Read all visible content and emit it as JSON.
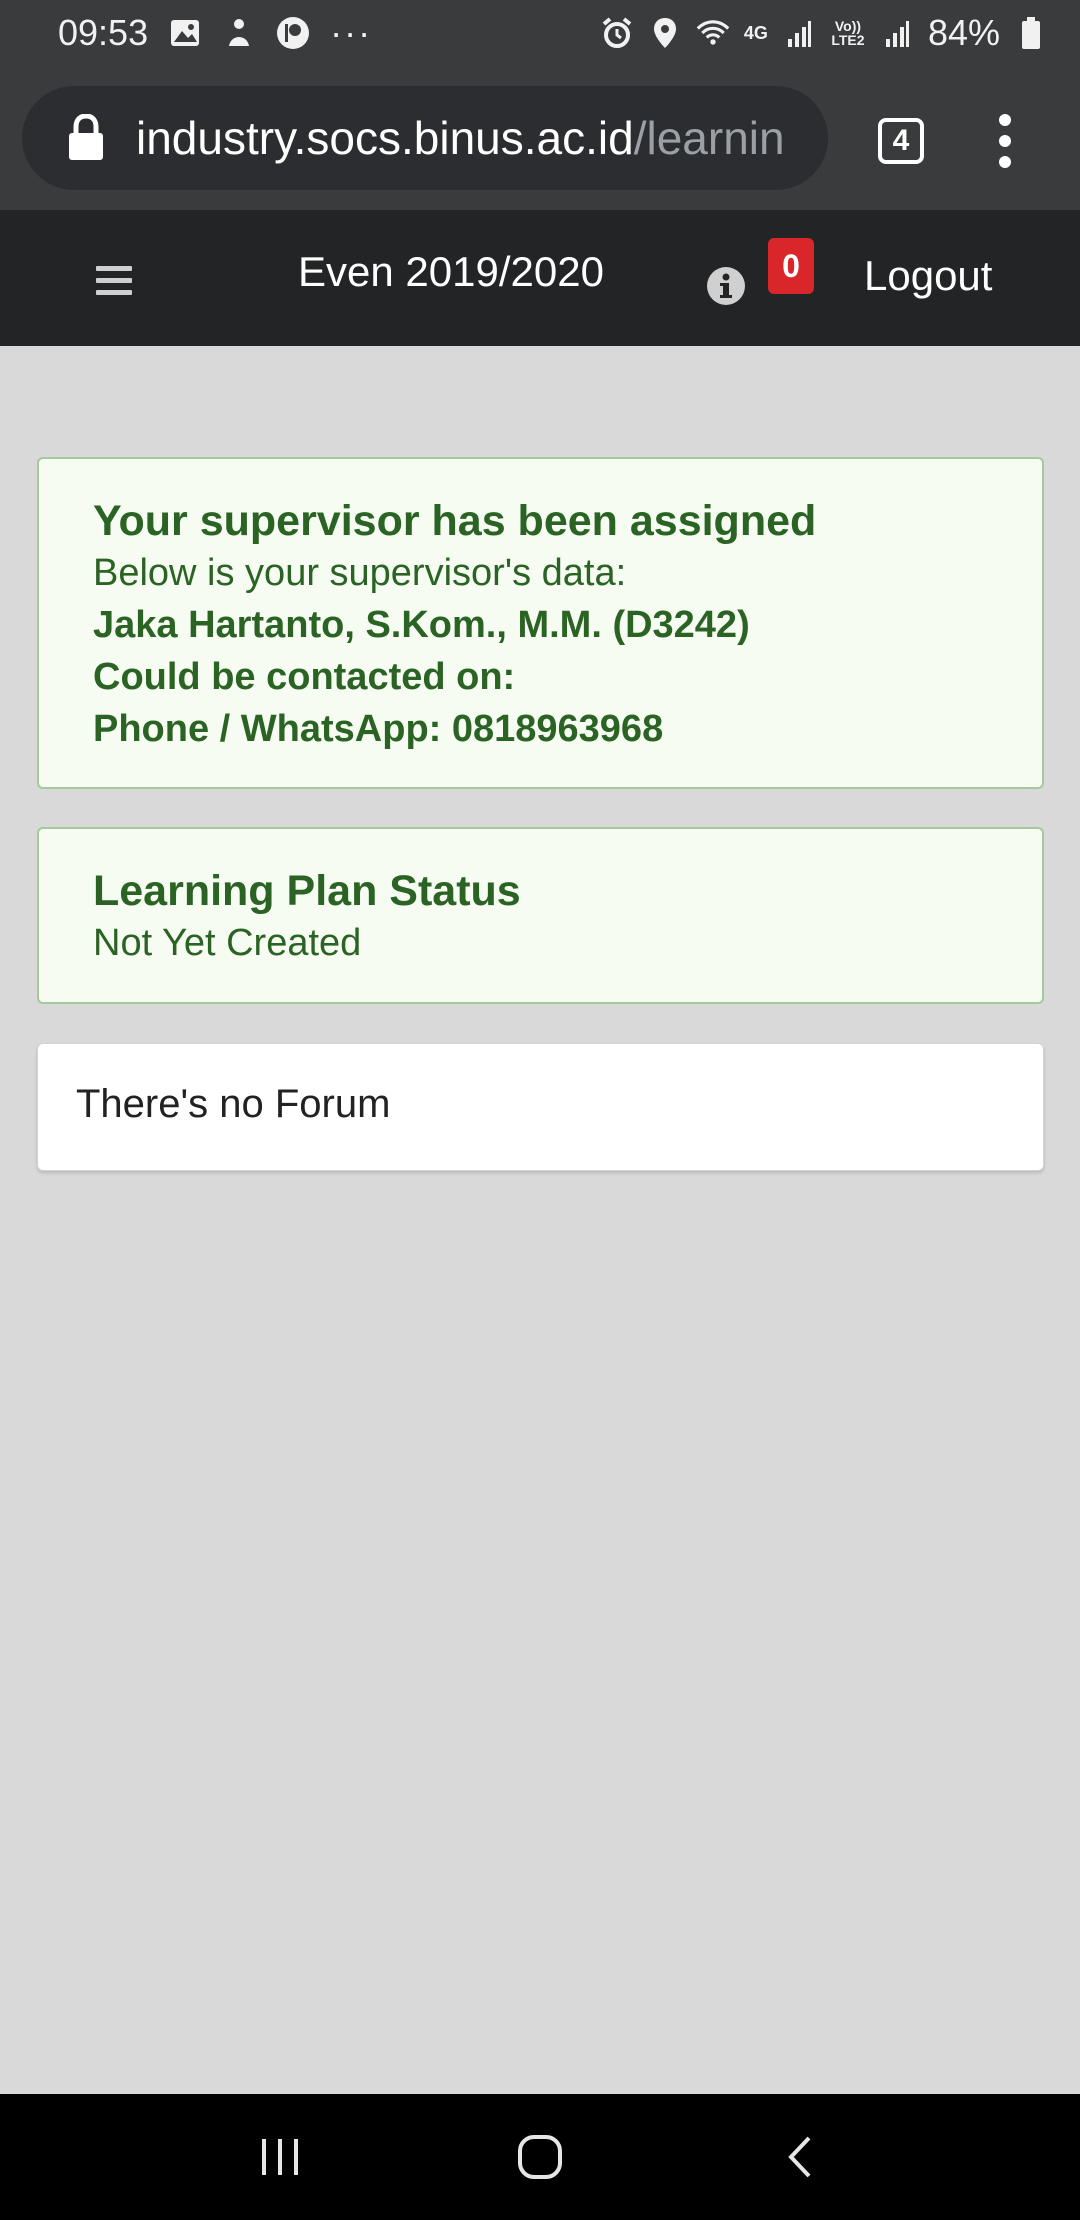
{
  "status_bar": {
    "time": "09:53",
    "more": "···",
    "network": "4G",
    "volte": "Vo)) LTE2",
    "battery": "84%"
  },
  "browser": {
    "url_host": "industry.socs.binus.ac.id",
    "url_path": "/learnin",
    "tab_count": "4"
  },
  "navbar": {
    "title": "Even 2019/2020",
    "notification_count": "0",
    "logout_label": "Logout"
  },
  "supervisor_card": {
    "title": "Your supervisor has been assigned",
    "subtitle": "Below is your supervisor's data:",
    "name": "Jaka Hartanto, S.Kom., M.M. (D3242)",
    "contact_label": "Could be contacted on:",
    "phone": "Phone / WhatsApp: 0818963968"
  },
  "learning_plan_card": {
    "title": "Learning Plan Status",
    "status": "Not Yet Created"
  },
  "forum_card": {
    "message": "There's no Forum"
  },
  "colors": {
    "card_text": "#2b6325",
    "card_bg": "#f6fcf1",
    "badge": "#d9262a",
    "navbar": "#222426"
  }
}
